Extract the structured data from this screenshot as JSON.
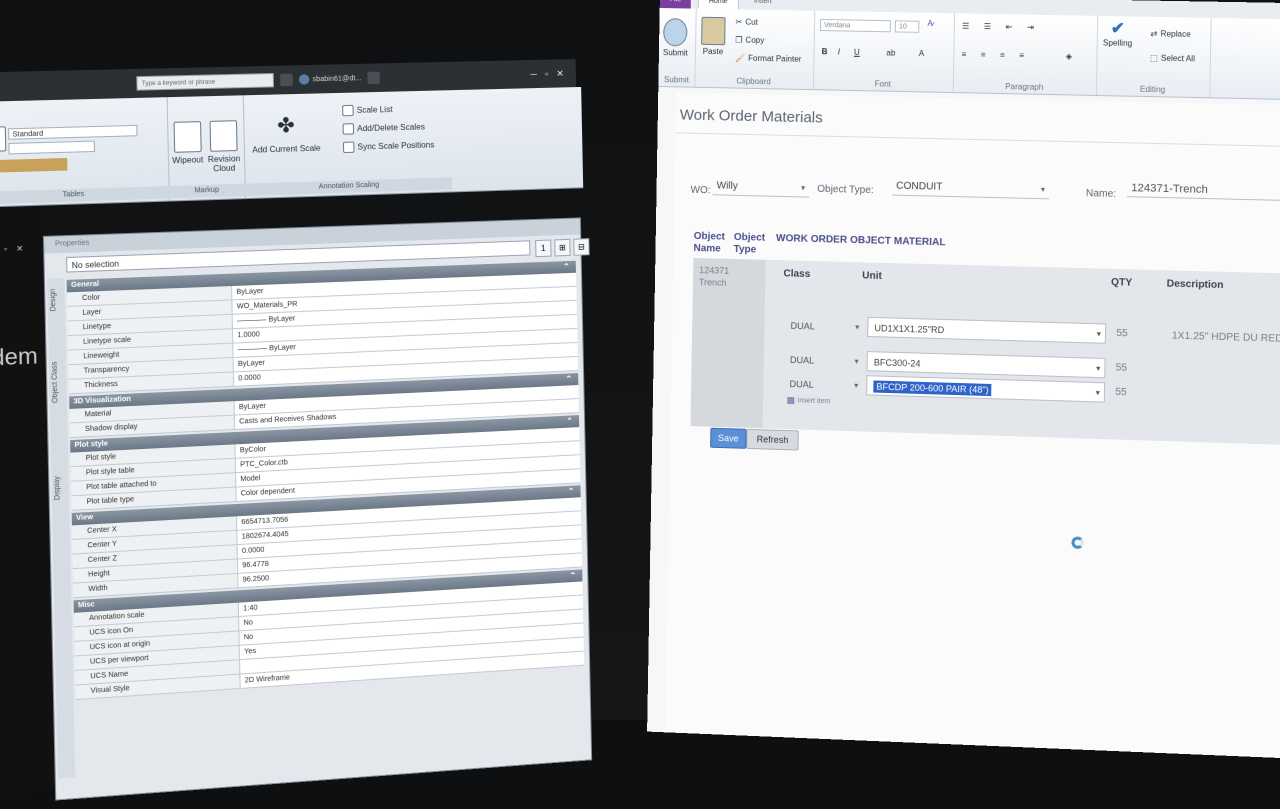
{
  "acad": {
    "search_placeholder": "Type a keyword or phrase",
    "user_label": "sbabin61@dt...",
    "ribbon": {
      "style_dropdown": "Standard",
      "wipeout": "Wipeout",
      "revision_cloud": "Revision Cloud",
      "add_current_scale": "Add Current Scale",
      "scale_list": "Scale List",
      "add_delete_scales": "Add/Delete Scales",
      "sync_scale_positions": "Sync Scale Positions",
      "panel_tables": "Tables",
      "panel_markup": "Markup",
      "panel_annotation_scaling": "Annotation Scaling"
    },
    "canvas_text": "dem",
    "canvas_controls": "─ ▫ ✕",
    "properties": {
      "header": "Properties",
      "selection": "No selection",
      "side_tabs": [
        "Design",
        "Object Class",
        "Display"
      ],
      "sections": [
        {
          "title": "General",
          "rows": [
            [
              "Color",
              "ByLayer"
            ],
            [
              "Layer",
              "WO_Materials_PR"
            ],
            [
              "Linetype",
              "———— ByLayer"
            ],
            [
              "Linetype scale",
              "1.0000"
            ],
            [
              "Lineweight",
              "———— ByLayer"
            ],
            [
              "Transparency",
              "ByLayer"
            ],
            [
              "Thickness",
              "0.0000"
            ]
          ]
        },
        {
          "title": "3D Visualization",
          "rows": [
            [
              "Material",
              "ByLayer"
            ],
            [
              "Shadow display",
              "Casts and Receives Shadows"
            ]
          ]
        },
        {
          "title": "Plot style",
          "rows": [
            [
              "Plot style",
              "ByColor"
            ],
            [
              "Plot style table",
              "PTC_Color.ctb"
            ],
            [
              "Plot table attached to",
              "Model"
            ],
            [
              "Plot table type",
              "Color dependent"
            ]
          ]
        },
        {
          "title": "View",
          "rows": [
            [
              "Center X",
              "6654713.7056"
            ],
            [
              "Center Y",
              "1802674.4045"
            ],
            [
              "Center Z",
              "0.0000"
            ],
            [
              "Height",
              "96.4778"
            ],
            [
              "Width",
              "96.2500"
            ]
          ]
        },
        {
          "title": "Misc",
          "rows": [
            [
              "Annotation scale",
              "1:40"
            ],
            [
              "UCS icon On",
              "No"
            ],
            [
              "UCS icon at origin",
              "No"
            ],
            [
              "UCS per viewport",
              "Yes"
            ],
            [
              "UCS Name",
              ""
            ],
            [
              "Visual Style",
              "2D Wireframe"
            ]
          ]
        }
      ]
    }
  },
  "word": {
    "tabs": {
      "file": "File",
      "home": "Home",
      "insert": "Insert"
    },
    "ribbon": {
      "submit": "Submit",
      "paste": "Paste",
      "cut": "Cut",
      "copy": "Copy",
      "format_painter": "Format Painter",
      "font_name": "Verdana",
      "font_size": "10",
      "bold": "B",
      "italic": "I",
      "underline": "U",
      "spelling": "Spelling",
      "replace": "Replace",
      "select_all": "Select All",
      "group_submit": "Submit",
      "group_clipboard": "Clipboard",
      "group_font": "Font",
      "group_paragraph": "Paragraph",
      "group_editing": "Editing"
    },
    "form": {
      "title": "Work Order Materials",
      "wo_label": "WO:",
      "wo_value": "Willy",
      "object_type_label": "Object Type:",
      "object_type_value": "CONDUIT",
      "name_label": "Name:",
      "name_value": "124371-Trench"
    },
    "grid": {
      "hdr_object_name": "Object Name",
      "hdr_object_type": "Object Type",
      "hdr_wo_object_material": "WORK ORDER OBJECT MATERIAL",
      "hdr_class": "Class",
      "hdr_unit": "Unit",
      "hdr_qty": "QTY",
      "hdr_description": "Description",
      "object_name_value": "124371 Trench",
      "rows": [
        {
          "class": "DUAL",
          "unit": "UD1X1X1.25\"RD",
          "qty": "55",
          "desc": "1X1.25\" HDPE DU RED"
        },
        {
          "class": "DUAL",
          "unit": "BFC300-24",
          "qty": "55",
          "desc": ""
        },
        {
          "class": "DUAL",
          "unit": "BFCDP 200-600 PAIR (48\")",
          "qty": "55",
          "desc": ""
        }
      ],
      "insert_item": "Insert item",
      "save": "Save",
      "refresh": "Refresh"
    }
  }
}
